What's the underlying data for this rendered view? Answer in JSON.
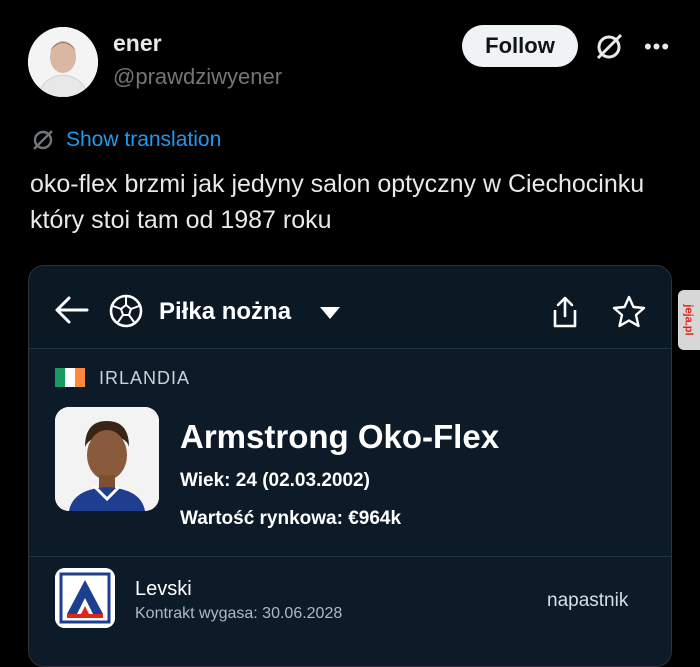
{
  "tweet": {
    "author_name": "ener",
    "author_handle": "@prawdziwyener",
    "follow_label": "Follow",
    "translate_label": "Show translation",
    "text": "oko-flex brzmi jak jedyny salon optyczny w Ciechocinku który stoi tam od 1987 roku"
  },
  "card": {
    "header": {
      "sport_label": "Piłka nożna",
      "icons": [
        "back-arrow-icon",
        "football-icon",
        "chevron-down-icon",
        "share-icon",
        "star-icon"
      ]
    },
    "player": {
      "country": "IRLANDIA",
      "flag_colors": [
        "#169b62",
        "#ffffff",
        "#ff883e"
      ],
      "name": "Armstrong Oko-Flex",
      "age": "Wiek: 24 (02.03.2002)",
      "market_value": "Wartość rynkowa: €964k"
    },
    "club": {
      "name": "Levski",
      "contract": "Kontrakt wygasa: 30.06.2028",
      "position": "napastnik"
    }
  },
  "watermark": {
    "text": "jeja.pl"
  },
  "colors": {
    "background": "#000000",
    "link": "#1d9bf0",
    "card_bg": "#0c1b27"
  }
}
